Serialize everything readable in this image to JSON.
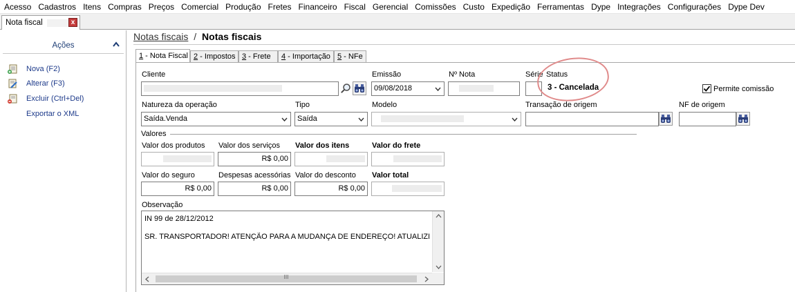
{
  "menu": [
    "Acesso",
    "Cadastros",
    "Itens",
    "Compras",
    "Preços",
    "Comercial",
    "Produção",
    "Fretes",
    "Financeiro",
    "Fiscal",
    "Gerencial",
    "Comissões",
    "Custo",
    "Expedição",
    "Ferramentas",
    "Dype",
    "Integrações",
    "Configurações",
    "Dype Dev"
  ],
  "doc_tab": {
    "label": "Nota fiscal",
    "close_label": "x"
  },
  "sidebar": {
    "title": "Ações",
    "actions": [
      {
        "label": "Nova (F2)",
        "icon": "new-document-icon"
      },
      {
        "label": "Alterar (F3)",
        "icon": "edit-document-icon"
      },
      {
        "label": "Excluir (Ctrl+Del)",
        "icon": "delete-document-icon"
      },
      {
        "label": "Exportar o XML",
        "icon": ""
      }
    ]
  },
  "breadcrumb": {
    "link": "Notas fiscais",
    "separator": "/",
    "current": "Notas fiscais"
  },
  "tabs": [
    {
      "num": "1",
      "label": " - Nota Fiscal"
    },
    {
      "num": "2",
      "label": " - Impostos"
    },
    {
      "num": "3",
      "label": " - Frete"
    },
    {
      "num": "4",
      "label": " - Importação"
    },
    {
      "num": "5",
      "label": " - NFe"
    }
  ],
  "labels": {
    "cliente": "Cliente",
    "emissao": "Emissão",
    "numero": "Nº Nota",
    "serie": "Série",
    "status": "Status",
    "natureza": "Natureza da operação",
    "tipo": "Tipo",
    "modelo": "Modelo",
    "transacao": "Transação de origem",
    "nf_origem": "NF de origem",
    "valores": "Valores",
    "valor_produtos": "Valor dos produtos",
    "valor_servicos": "Valor dos serviços",
    "valor_itens": "Valor dos itens",
    "valor_frete": "Valor do frete",
    "valor_seguro": "Valor do seguro",
    "despesas": "Despesas acessórias",
    "valor_desconto": "Valor do desconto",
    "valor_total": "Valor total",
    "observacao": "Observação"
  },
  "fields": {
    "emissao": "09/08/2018",
    "status": "3 - Cancelada",
    "permite_comissao": "Permite comissão",
    "permite_comissao_checked": true,
    "natureza": "Saída.Venda",
    "tipo": "Saída",
    "valor_servicos": "R$ 0,00",
    "valor_seguro": "R$ 0,00",
    "despesas": "R$ 0,00",
    "valor_desconto": "R$ 0,00"
  },
  "observacao": [
    "IN 99 de 28/12/2012",
    "SR. TRANSPORTADOR! ATENÇÃO PARA A MUDANÇA DE ENDEREÇO! ATUALIZE O SEU"
  ],
  "scroll_grip": "III"
}
